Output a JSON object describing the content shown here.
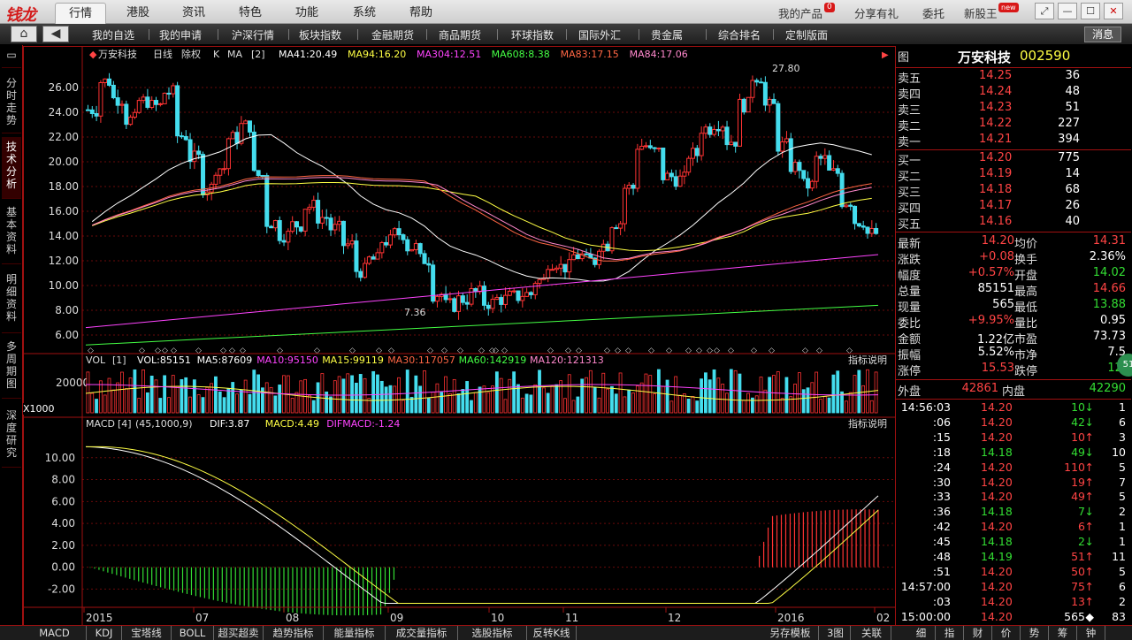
{
  "app": {
    "logo": "钱龙",
    "menu_tabs": [
      "行情",
      "港股",
      "资讯",
      "特色",
      "功能",
      "系统",
      "帮助"
    ],
    "top_links": [
      "我的产品",
      "分享有礼",
      "委托",
      "新股王"
    ],
    "my_products_badge": "0",
    "new_badge": "new"
  },
  "nav": {
    "items": [
      "我的自选",
      "我的申请",
      "沪深行情",
      "板块指数",
      "金融期货",
      "商品期货",
      "环球指数",
      "国际外汇",
      "贵金属",
      "综合排名",
      "定制版面"
    ],
    "quit": "消息"
  },
  "left_tabs": [
    "分时走势",
    "技术分析",
    "基本资料",
    "明细资料",
    "多周期图",
    "深度研究"
  ],
  "x1000": "X1000",
  "kline_header": {
    "stock": "万安科技",
    "period": "日线",
    "adjust": "除权",
    "type": "K",
    "indicator": "MA",
    "param": "[2]",
    "ma": [
      {
        "label": "MA41:20.49",
        "color": "#ffffff"
      },
      {
        "label": "MA94:16.20",
        "color": "#ffff44"
      },
      {
        "label": "MA304:12.51",
        "color": "#ff44ff"
      },
      {
        "label": "MA608:8.38",
        "color": "#44ff44"
      },
      {
        "label": "MA83:17.15",
        "color": "#ff6644"
      },
      {
        "label": "MA84:17.06",
        "color": "#ff88cc"
      }
    ]
  },
  "vol_header": {
    "label": "VOL",
    "param": "[1]",
    "items": [
      {
        "label": "VOL:85151",
        "color": "#ffffff"
      },
      {
        "label": "MA5:87609",
        "color": "#ffffff"
      },
      {
        "label": "MA10:95150",
        "color": "#ff44ff"
      },
      {
        "label": "MA15:99119",
        "color": "#ffff44"
      },
      {
        "label": "MA30:117057",
        "color": "#ff6644"
      },
      {
        "label": "MA60:142919",
        "color": "#44ff44"
      },
      {
        "label": "MA120:121313",
        "color": "#ff88cc"
      }
    ],
    "help": "指标说明"
  },
  "macd_header": {
    "label": "MACD",
    "param": "[4]",
    "params": "(45,1000,9)",
    "items": [
      {
        "label": "DIF:3.87",
        "color": "#ffffff"
      },
      {
        "label": "MACD:4.49",
        "color": "#ffff44"
      },
      {
        "label": "DIFMACD:-1.24",
        "color": "#ff44ff"
      }
    ],
    "help": "指标说明"
  },
  "kline_yticks": [
    "26.00",
    "24.00",
    "22.00",
    "20.00",
    "18.00",
    "16.00",
    "14.00",
    "12.00",
    "10.00",
    "8.00",
    "6.00"
  ],
  "vol_ytick": "20000",
  "macd_yticks": [
    "10.00",
    "8.00",
    "6.00",
    "4.00",
    "2.00",
    "0.00",
    "-2.00"
  ],
  "xlabels": [
    "2015",
    "07",
    "08",
    "09",
    "10",
    "11",
    "12",
    "2016",
    "02"
  ],
  "annotations": {
    "high": "27.80",
    "low": "7.36"
  },
  "chart_data": {
    "type": "candlestick",
    "price_range": [
      5,
      28
    ],
    "high": 27.8,
    "low": 7.36,
    "closes": [
      24.2,
      26.5,
      25.1,
      23.4,
      24.9,
      24.5,
      25.6,
      22.1,
      20.3,
      17.9,
      19.5,
      21.9,
      22.9,
      18.9,
      15.1,
      14.1,
      14.9,
      16.4,
      15.5,
      14.6,
      13.3,
      11.2,
      12.1,
      13.6,
      14.2,
      13.1,
      12.1,
      9.3,
      8.4,
      8.9,
      9.4,
      8.6,
      8.9,
      9.1,
      9.3,
      10.4,
      11.9,
      11.5,
      12.4,
      12.0,
      13.3,
      15.1,
      17.9,
      21.3,
      20.8,
      18.8,
      18.6,
      20.6,
      22.7,
      23.1,
      21.7,
      24.6,
      26.9,
      24.5,
      21.3,
      19.6,
      18.1,
      20.2,
      19.1,
      16.8,
      15.2,
      14.2
    ],
    "volume_max": 28000,
    "macd_range": [
      -3.5,
      12
    ]
  },
  "quote": {
    "name": "万安科技",
    "code": "002590",
    "asks": [
      {
        "l": "卖五",
        "p": "14.25",
        "v": "36"
      },
      {
        "l": "卖四",
        "p": "14.24",
        "v": "48"
      },
      {
        "l": "卖三",
        "p": "14.23",
        "v": "51"
      },
      {
        "l": "卖二",
        "p": "14.22",
        "v": "227"
      },
      {
        "l": "卖一",
        "p": "14.21",
        "v": "394"
      }
    ],
    "bids": [
      {
        "l": "买一",
        "p": "14.20",
        "v": "775"
      },
      {
        "l": "买二",
        "p": "14.19",
        "v": "14"
      },
      {
        "l": "买三",
        "p": "14.18",
        "v": "68"
      },
      {
        "l": "买四",
        "p": "14.17",
        "v": "26"
      },
      {
        "l": "买五",
        "p": "14.16",
        "v": "40"
      }
    ],
    "stats": [
      {
        "l1": "最新",
        "v1": "14.20",
        "c1": "up",
        "l2": "均价",
        "v2": "14.31",
        "c2": "up"
      },
      {
        "l1": "涨跌",
        "v1": "+0.08",
        "c1": "up",
        "l2": "换手",
        "v2": "2.36%",
        "c2": "wh"
      },
      {
        "l1": "幅度",
        "v1": "+0.57%",
        "c1": "up",
        "l2": "开盘",
        "v2": "14.02",
        "c2": "dn"
      },
      {
        "l1": "总量",
        "v1": "85151",
        "c1": "wh",
        "l2": "最高",
        "v2": "14.66",
        "c2": "up"
      },
      {
        "l1": "现量",
        "v1": "565",
        "c1": "wh",
        "l2": "最低",
        "v2": "13.88",
        "c2": "dn"
      },
      {
        "l1": "委比",
        "v1": "+9.95%",
        "c1": "up",
        "l2": "量比",
        "v2": "0.95",
        "c2": "wh"
      },
      {
        "l1": "金额",
        "v1": "1.22亿",
        "c1": "wh",
        "l2": "市盈",
        "v2": "73.73",
        "c2": "wh"
      },
      {
        "l1": "振幅",
        "v1": "5.52%",
        "c1": "wh",
        "l2": "市净",
        "v2": "7.5",
        "c2": "wh"
      },
      {
        "l1": "涨停",
        "v1": "15.53",
        "c1": "up",
        "l2": "跌停",
        "v2": "12.",
        "c2": "dn"
      }
    ],
    "outer": {
      "l": "外盘",
      "v": "42861"
    },
    "inner": {
      "l": "内盘",
      "v": "42290"
    },
    "ticks": [
      {
        "t": "14:56:03",
        "p": "14.20",
        "v": "10",
        "a": "↓",
        "ac": "dn",
        "n": "1"
      },
      {
        "t": ":06",
        "p": "14.20",
        "v": "42",
        "a": "↓",
        "ac": "dn",
        "n": "6"
      },
      {
        "t": ":15",
        "p": "14.20",
        "v": "10",
        "a": "↑",
        "ac": "up",
        "n": "3"
      },
      {
        "t": ":18",
        "p": "14.18",
        "v": "49",
        "a": "↓",
        "ac": "dn",
        "n": "10"
      },
      {
        "t": ":24",
        "p": "14.20",
        "v": "110",
        "a": "↑",
        "ac": "up",
        "n": "5"
      },
      {
        "t": ":30",
        "p": "14.20",
        "v": "19",
        "a": "↑",
        "ac": "up",
        "n": "7"
      },
      {
        "t": ":33",
        "p": "14.20",
        "v": "49",
        "a": "↑",
        "ac": "up",
        "n": "5"
      },
      {
        "t": ":36",
        "p": "14.18",
        "v": "7",
        "a": "↓",
        "ac": "dn",
        "n": "2"
      },
      {
        "t": ":42",
        "p": "14.20",
        "v": "6",
        "a": "↑",
        "ac": "up",
        "n": "1"
      },
      {
        "t": ":45",
        "p": "14.18",
        "v": "2",
        "a": "↓",
        "ac": "dn",
        "n": "1"
      },
      {
        "t": ":48",
        "p": "14.19",
        "v": "51",
        "a": "↑",
        "ac": "up",
        "n": "11"
      },
      {
        "t": ":51",
        "p": "14.20",
        "v": "50",
        "a": "↑",
        "ac": "up",
        "n": "5"
      },
      {
        "t": "14:57:00",
        "p": "14.20",
        "v": "75",
        "a": "↑",
        "ac": "up",
        "n": "6"
      },
      {
        "t": ":03",
        "p": "14.20",
        "v": "13",
        "a": "↑",
        "ac": "up",
        "n": "2"
      },
      {
        "t": "15:00:00",
        "p": "14.20",
        "v": "565",
        "a": "◆",
        "ac": "wh",
        "n": "83"
      }
    ],
    "side_badge": "51"
  },
  "bottom_tabs": [
    "MACD",
    "KDJ",
    "宝塔线",
    "BOLL",
    "超买超卖",
    "趋势指标",
    "能量指标",
    "成交量指标",
    "选股指标",
    "反转K线"
  ],
  "bottom_right": [
    "另存模板",
    "3图",
    "关联"
  ],
  "right_bottom_tabs": [
    "细",
    "指",
    "财",
    "价",
    "势",
    "筹",
    "钟"
  ],
  "colors": {
    "up": "#ff3333",
    "down": "#33dd33",
    "frame": "#a01010",
    "bar_cyan": "#44ddee"
  }
}
